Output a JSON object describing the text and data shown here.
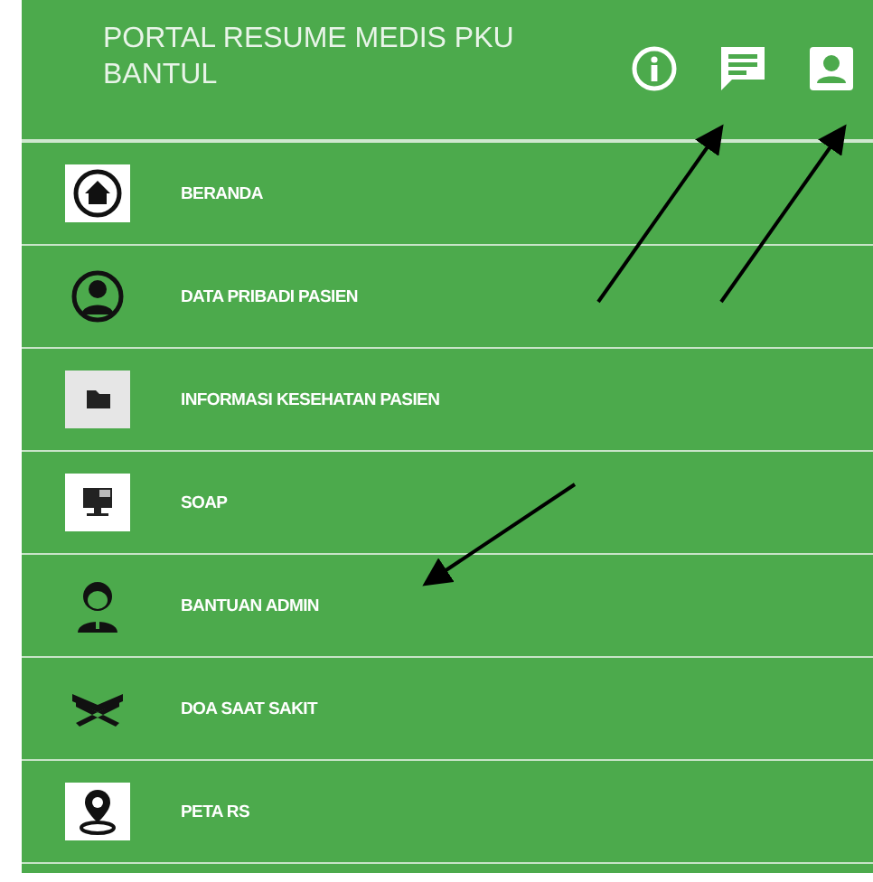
{
  "header": {
    "title": "PORTAL RESUME MEDIS PKU BANTUL"
  },
  "menu": [
    {
      "label": "BERANDA"
    },
    {
      "label": "DATA PRIBADI PASIEN"
    },
    {
      "label": "INFORMASI KESEHATAN PASIEN"
    },
    {
      "label": "SOAP"
    },
    {
      "label": "BANTUAN ADMIN"
    },
    {
      "label": "DOA SAAT SAKIT"
    },
    {
      "label": "PETA RS"
    }
  ]
}
